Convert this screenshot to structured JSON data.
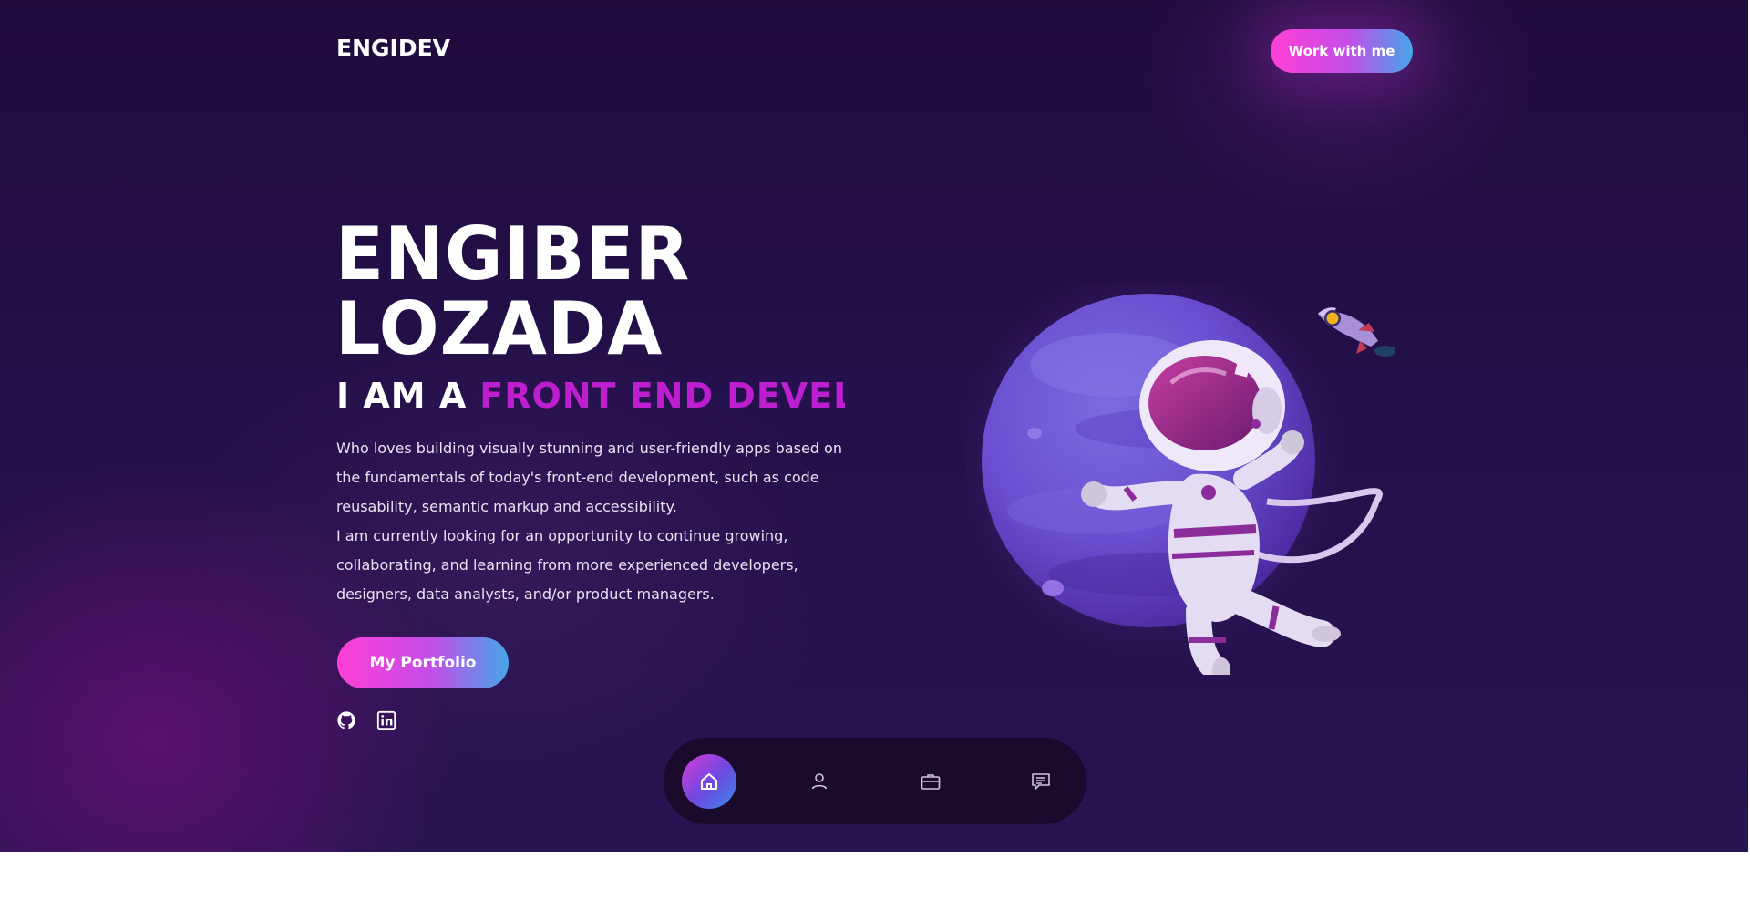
{
  "header": {
    "logo": "ENGIDEV",
    "cta_label": "Work with me"
  },
  "hero": {
    "name_line1": "ENGIBER",
    "name_line2": "LOZADA",
    "iam_prefix": "I AM A",
    "iam_role": "FRONT END DEVELOPER",
    "bio_paragraph1": "Who loves building visually stunning and user-friendly apps based on the fundamentals of today's front-end development, such as code reusability, semantic markup and accessibility.",
    "bio_paragraph2": "I am currently looking for an opportunity to continue growing, collaborating, and learning from more experienced developers, designers, data analysts, and/or product managers.",
    "portfolio_label": "My Portfolio"
  },
  "social": [
    {
      "icon": "github-icon"
    },
    {
      "icon": "linkedin-icon"
    }
  ],
  "nav": {
    "items": [
      {
        "icon": "home-icon",
        "active": true
      },
      {
        "icon": "user-icon",
        "active": false
      },
      {
        "icon": "briefcase-icon",
        "active": false
      },
      {
        "icon": "message-icon",
        "active": false
      }
    ]
  },
  "colors": {
    "background": "#24104a",
    "accent_pink": "#ff3fd6",
    "accent_blue": "#45a6e8",
    "role_text": "#bd1fd0",
    "nav_dock": "#1a0b2c"
  }
}
